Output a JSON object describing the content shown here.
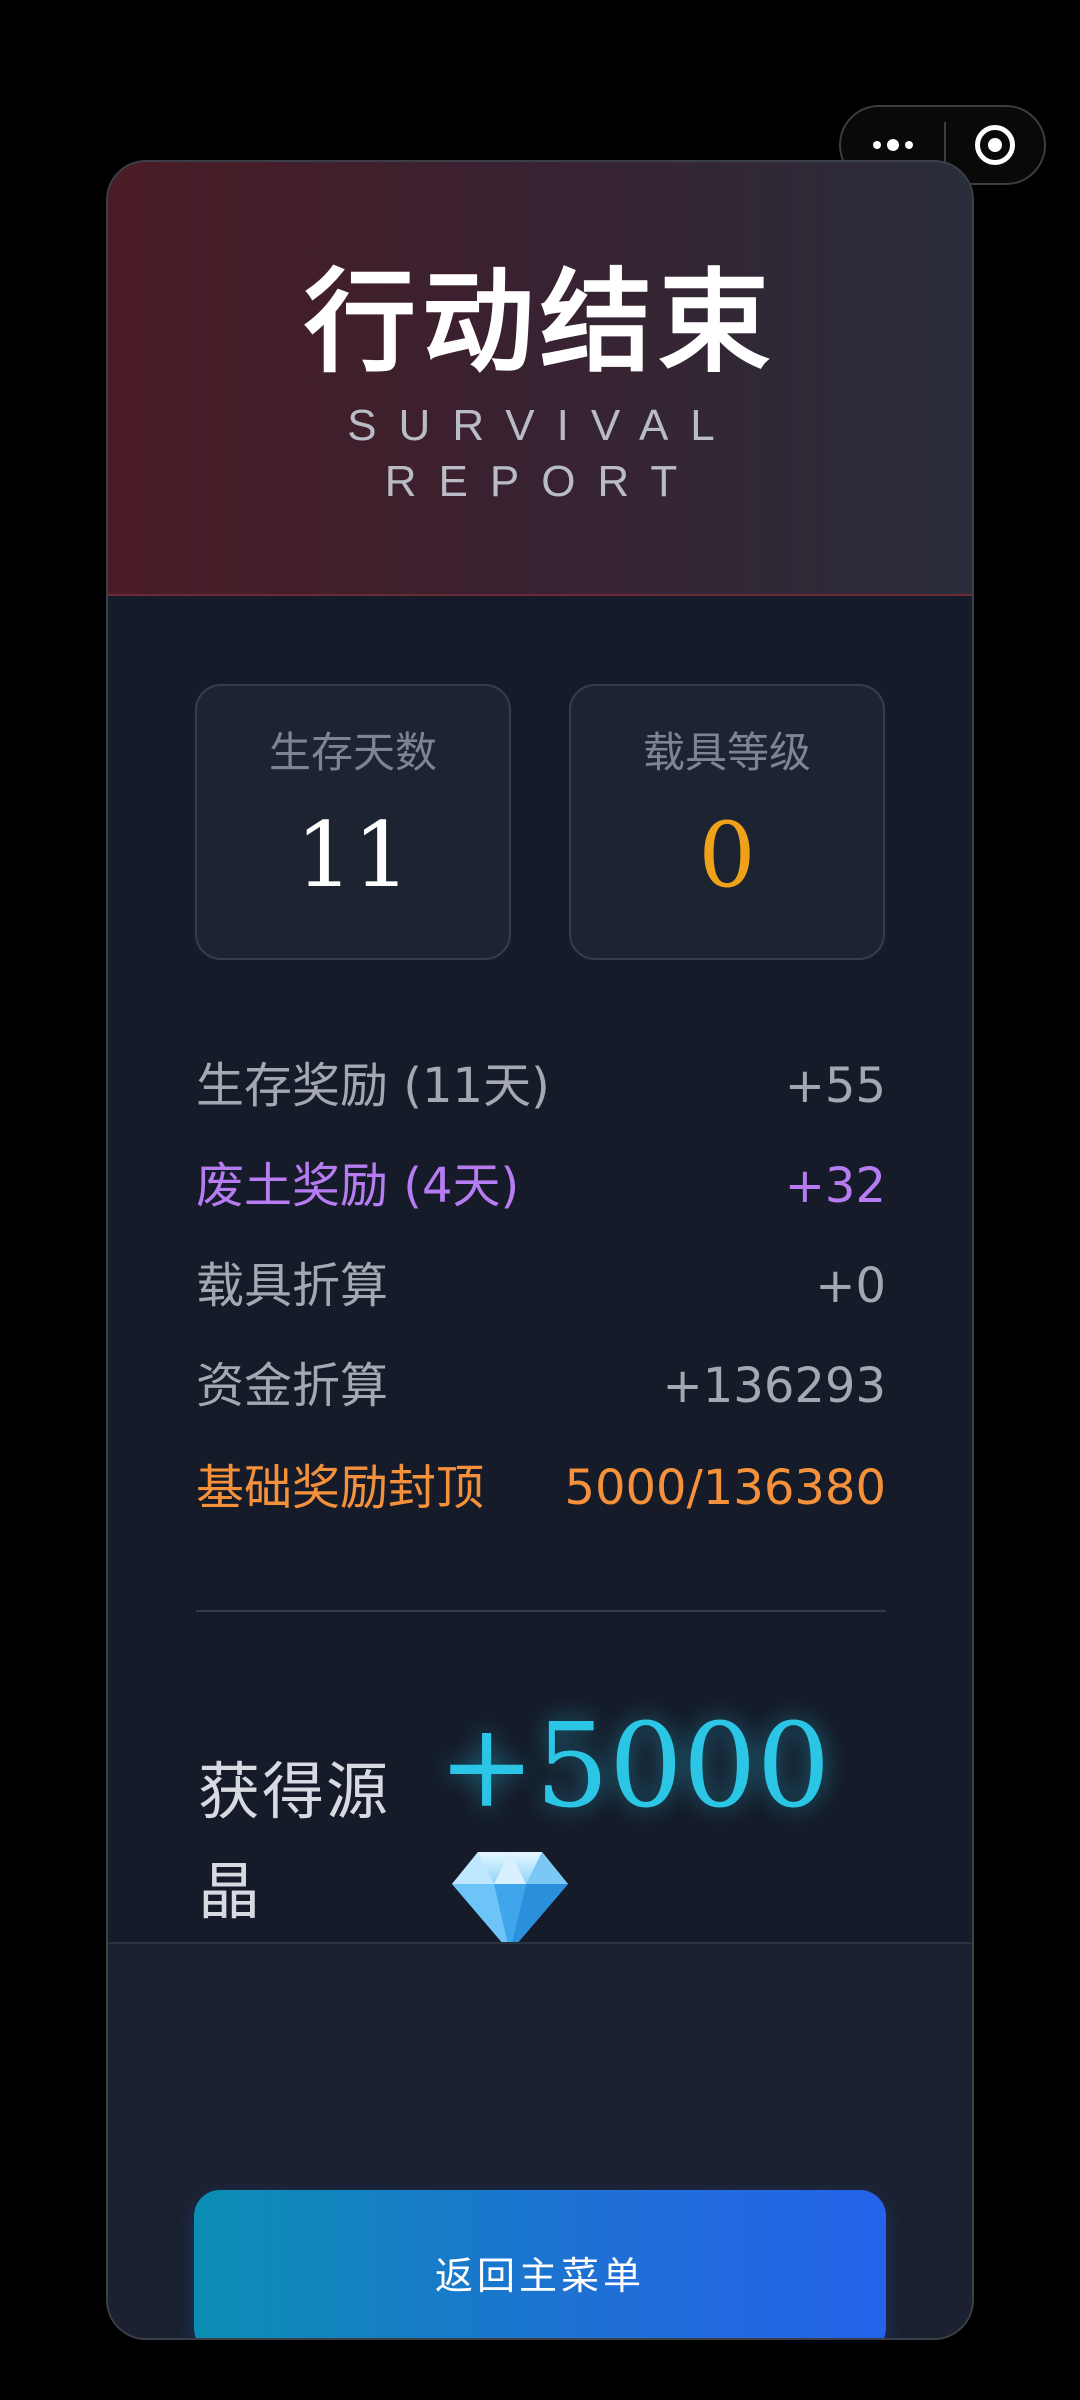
{
  "header": {
    "title": "行动结束",
    "subtitle_line1": "SURVIVAL",
    "subtitle_line2": "REPORT"
  },
  "stats": [
    {
      "label": "生存天数",
      "value": "11"
    },
    {
      "label": "载具等级",
      "value": "0"
    }
  ],
  "rewards": [
    {
      "label": "生存奖励 (11天)",
      "value": "+55"
    },
    {
      "label": "废土奖励 (4天)",
      "value": "+32"
    },
    {
      "label": "载具折算",
      "value": "+0"
    },
    {
      "label": "资金折算",
      "value": "+136293"
    },
    {
      "label": "基础奖励封顶",
      "value": "5000/136380"
    }
  ],
  "gain": {
    "label": "获得源晶",
    "value": "+5000",
    "icon": "diamond-icon"
  },
  "footer": {
    "back_button_label": "返回主菜单"
  },
  "capsule": {
    "more_icon": "more-icon",
    "close_icon": "target-icon"
  },
  "colors": {
    "accent_orange": "#f0a11a",
    "purple": "#b77cf2",
    "cap_orange": "#f5913b",
    "gain_cyan": "#2bc6e6",
    "button_start": "#0b8eb3",
    "button_end": "#2563eb"
  }
}
